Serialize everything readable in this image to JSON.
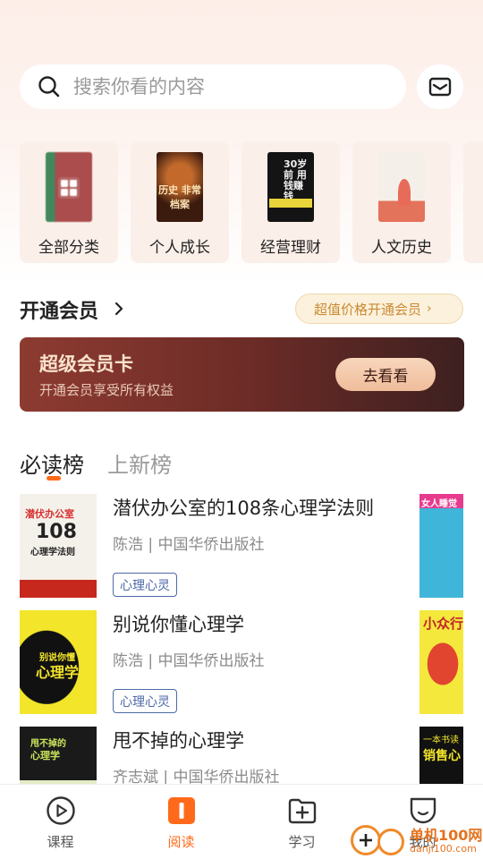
{
  "search": {
    "placeholder": "搜索你看的内容"
  },
  "categories": [
    {
      "label": "全部分类",
      "cover_text": ""
    },
    {
      "label": "个人成长",
      "cover_text": "历史 非常档案"
    },
    {
      "label": "经营理财",
      "cover_text": "30岁前 用钱赚钱"
    },
    {
      "label": "人文历史",
      "cover_text": ""
    }
  ],
  "membership": {
    "title": "开通会员",
    "promo": "超值价格开通会员",
    "card_title": "超级会员卡",
    "card_subtitle": "开通会员享受所有权益",
    "card_button": "去看看"
  },
  "tabs": [
    {
      "label": "必读榜",
      "active": true
    },
    {
      "label": "上新榜",
      "active": false
    }
  ],
  "books": [
    {
      "title": "潜伏办公室的108条心理学法则",
      "meta": "陈浩 | 中国华侨出版社",
      "tag": "心理心灵",
      "cover_lines": [
        "潜伏办公室",
        "108",
        "心理学法则"
      ],
      "side_cover_text": "女人睡觉"
    },
    {
      "title": "别说你懂心理学",
      "meta": "陈浩 | 中国华侨出版社",
      "tag": "心理心灵",
      "cover_lines": [
        "别说你懂",
        "心理学"
      ],
      "side_cover_text": "小众行 心"
    },
    {
      "title": "甩不掉的心理学",
      "meta": "齐志斌 | 中国华侨出版社",
      "tag": "",
      "cover_lines": [
        "甩不掉的",
        "心理学"
      ],
      "side_cover_text": [
        "一本书读",
        "销售心"
      ]
    }
  ],
  "bottom_nav": [
    {
      "label": "课程",
      "icon": "play-circle-icon",
      "active": false
    },
    {
      "label": "阅读",
      "icon": "book-reading-icon",
      "active": true
    },
    {
      "label": "学习",
      "icon": "add-folder-icon",
      "active": false
    },
    {
      "label": "我的",
      "icon": "profile-face-icon",
      "active": false
    }
  ],
  "watermark": {
    "line1": "单机100网",
    "line2": "danji100.com"
  },
  "colors": {
    "accent": "#ff6a1a",
    "tag_blue": "#4d6aa8",
    "vip_card": "#7a3129",
    "promo_text": "#c98a32"
  }
}
